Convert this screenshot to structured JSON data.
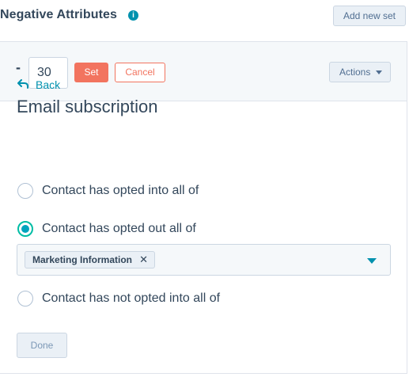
{
  "header": {
    "title": "Negative Attributes",
    "info_icon": "info-icon",
    "add_set_label": "Add new set"
  },
  "toolbar": {
    "minus": "-",
    "value": "30",
    "set_label": "Set",
    "cancel_label": "Cancel",
    "actions_label": "Actions"
  },
  "nav": {
    "back_label": "Back",
    "back_icon": "back-arrow-icon"
  },
  "section": {
    "title": "Email subscription"
  },
  "options": [
    {
      "label": "Contact has opted into all of",
      "selected": false
    },
    {
      "label": "Contact has opted out all of",
      "selected": true
    },
    {
      "label": "Contact has not opted into all of",
      "selected": false
    }
  ],
  "tag_select": {
    "tags": [
      {
        "label": "Marketing Information",
        "remove": "✕"
      }
    ],
    "caret_icon": "chevron-down-icon"
  },
  "footer": {
    "done_label": "Done"
  },
  "colors": {
    "accent_teal": "#00bda5",
    "link_blue": "#0091ae",
    "primary_orange": "#f2745f",
    "text": "#33475b",
    "panel_bg": "#f5f8fa"
  }
}
